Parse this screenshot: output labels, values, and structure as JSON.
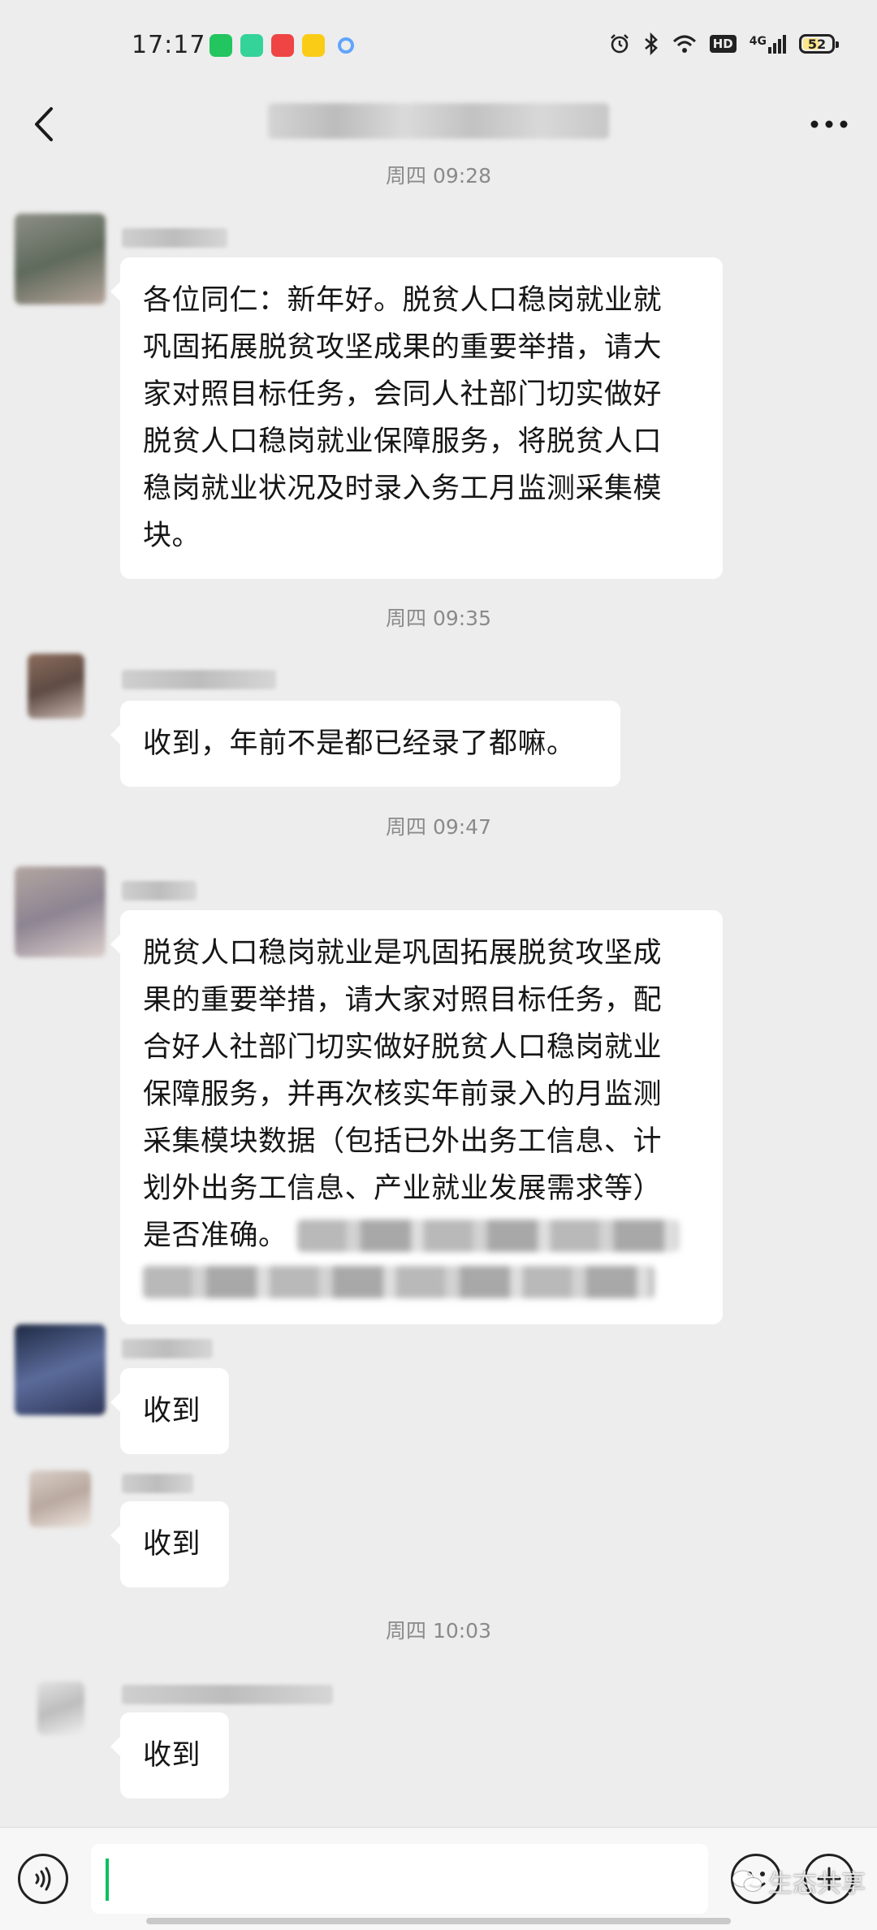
{
  "status_bar": {
    "time": "17:17",
    "app_icons": [
      {
        "name": "tv-app-icon",
        "color": "#22c55e"
      },
      {
        "name": "notes-app-icon",
        "color": "#34d399"
      },
      {
        "name": "eye-app-icon",
        "color": "#ef4444"
      },
      {
        "name": "heart-app-icon",
        "color": "#facc15"
      },
      {
        "name": "dot-app-icon",
        "color": "#60a5fa"
      }
    ],
    "hd_label": "HD",
    "network_label": "4G",
    "battery_level": "52"
  },
  "header": {
    "back_icon": "chevron-left-icon",
    "title": "████ ████",
    "more_icon": "more-dots-icon"
  },
  "messages": [
    {
      "timestamp": "周四 09:28",
      "avatar_colors": [
        "#8d8f86",
        "#5f6a5c",
        "#b5a49a"
      ],
      "sender": "██████",
      "lines": [
        "各位同仁：新年好。脱贫人口稳岗就业就",
        "巩固拓展脱贫攻坚成果的重要举措，请大",
        "家对照目标任务，会同人社部门切实做好",
        "脱贫人口稳岗就业保障服务，将脱贫人口",
        "稳岗就业状况及时录入务工月监测采集模",
        "块。"
      ]
    },
    {
      "timestamp": "周四 09:35",
      "avatar_colors": [
        "#8c6d5c",
        "#5e4b44",
        "#c8b7b0"
      ],
      "sender": "████████",
      "lines": [
        "收到，年前不是都已经录了都嘛。"
      ]
    },
    {
      "timestamp": "周四 09:47",
      "avatar_colors": [
        "#b3a6a0",
        "#8d8492",
        "#dccfcc"
      ],
      "sender": "████",
      "lines": [
        "脱贫人口稳岗就业是巩固拓展脱贫攻坚成",
        "果的重要举措，请大家对照目标任务，配",
        "合好人社部门切实做好脱贫人口稳岗就业",
        "保障服务，并再次核实年前录入的月监测",
        "采集模块数据（包括已外出务工信息、计",
        "划外出务工信息、产业就业发展需求等）",
        "是否准确。"
      ],
      "redacted": [
        "██████ ██████ ██████",
        "████ ████ ██████ ██████"
      ]
    },
    {
      "avatar_colors": [
        "#1f2a44",
        "#5b6b9a",
        "#2d3558"
      ],
      "sender": "█████",
      "lines": [
        "收到"
      ]
    },
    {
      "avatar_colors": [
        "#d8cfc9",
        "#b9a89e",
        "#efe7e2"
      ],
      "sender": "████",
      "lines": [
        "收到"
      ]
    },
    {
      "timestamp": "周四 10:03",
      "avatar_colors": [
        "#e2e2e2",
        "#bdbdbd",
        "#f0f0f0"
      ],
      "sender": "███████",
      "lines": [
        "收到"
      ]
    }
  ],
  "input_bar": {
    "voice_icon": "voice-icon",
    "emoji_icon": "emoji-icon",
    "plus_icon": "plus-icon"
  },
  "watermark": {
    "text": "生态共享"
  }
}
